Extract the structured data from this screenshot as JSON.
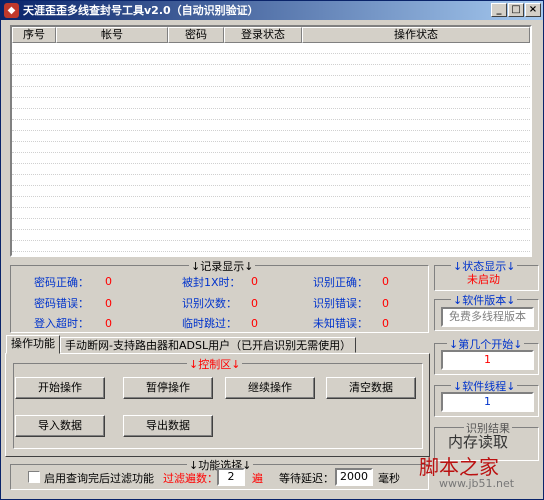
{
  "window": {
    "title": "天涯歪歪多线查封号工具v2.0（自动识别验证）",
    "app_icon": "app-icon",
    "minimize_label": "_",
    "maximize_label": "□",
    "close_label": "×"
  },
  "table": {
    "columns": [
      "序号",
      "帐号",
      "密码",
      "登录状态",
      "操作状态"
    ]
  },
  "records": {
    "title": "↓记录显示↓",
    "stats": [
      {
        "label": "密码正确：",
        "value": "0"
      },
      {
        "label": "被封1X时：",
        "value": "0"
      },
      {
        "label": "识别正确：",
        "value": "0"
      },
      {
        "label": "密码错误：",
        "value": "0"
      },
      {
        "label": "识别次数：",
        "value": "0"
      },
      {
        "label": "识别错误：",
        "value": "0"
      },
      {
        "label": "登入超时：",
        "value": "0"
      },
      {
        "label": "临时跳过：",
        "value": "0"
      },
      {
        "label": "未知错误：",
        "value": "0"
      }
    ]
  },
  "status": {
    "title": "↓状态显示↓",
    "value": "未启动"
  },
  "version": {
    "title": "↓软件版本↓",
    "value": "免费多线程版本"
  },
  "start_at": {
    "title": "↓第几个开始↓",
    "value": "1"
  },
  "threads": {
    "title": "↓软件线程↓",
    "value": "1"
  },
  "captcha": {
    "title": "识别结果",
    "value": "内存读取"
  },
  "tabs": {
    "tab1": "操作功能",
    "tab2": "手动断网-支持路由器和ADSL用户（已开启识别无需使用）"
  },
  "control": {
    "title": "↓控制区↓",
    "start": "开始操作",
    "pause": "暂停操作",
    "resume": "继续操作",
    "clear": "清空数据",
    "import": "导入数据",
    "export": "导出数据"
  },
  "options": {
    "title": "↓功能选择↓",
    "filter_label": "启用查询完后过滤功能",
    "filter_count_label": "过滤遍数：",
    "filter_count": "2",
    "filter_count_unit": "遍",
    "delay_label": "等待延迟：",
    "delay_value": "2000",
    "delay_unit": "毫秒"
  },
  "watermark": {
    "text": "脚本之家",
    "url": "www.jb51.net"
  }
}
